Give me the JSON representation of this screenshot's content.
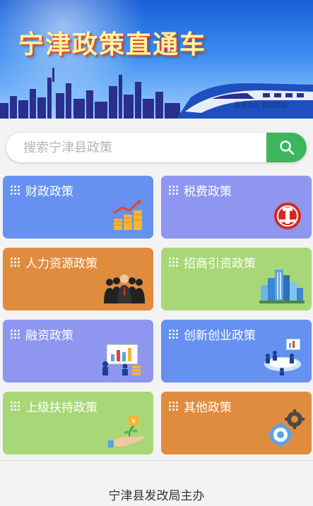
{
  "banner": {
    "title": "宁津政策直通车",
    "train_slogan": "服务企业 服务群众"
  },
  "search": {
    "placeholder": "搜索宁津县政策",
    "value": "",
    "button_icon": "search-icon"
  },
  "colors": {
    "blue": "#6691f0",
    "lavender": "#8e96f0",
    "orange": "#e08c3e",
    "green": "#a8d778",
    "search_green": "#3cb55d"
  },
  "categories": [
    {
      "label": "财政政策",
      "color": "blue",
      "icon": "coins-chart-icon"
    },
    {
      "label": "税费政策",
      "color": "lavender",
      "icon": "tax-emblem-icon"
    },
    {
      "label": "人力资源政策",
      "color": "orange",
      "icon": "business-people-icon"
    },
    {
      "label": "招商引资政策",
      "color": "green",
      "icon": "city-buildings-icon"
    },
    {
      "label": "融资政策",
      "color": "lavender",
      "icon": "presentation-icon"
    },
    {
      "label": "创新创业政策",
      "color": "blue",
      "icon": "team-meeting-icon"
    },
    {
      "label": "上级扶持政策",
      "color": "green",
      "icon": "hand-plant-coin-icon"
    },
    {
      "label": "其他政策",
      "color": "orange",
      "icon": "gears-icon"
    }
  ],
  "footer": {
    "text": "宁津县发改局主办"
  }
}
